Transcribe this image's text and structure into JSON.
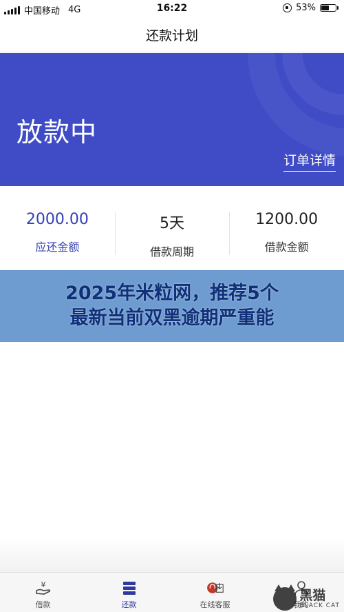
{
  "status_bar": {
    "carrier": "中国移动",
    "network": "4G",
    "time": "16:22",
    "battery": "53%",
    "battery_level": 0.53
  },
  "nav": {
    "title": "还款计划"
  },
  "banner": {
    "status": "放款中",
    "detail_link": "订单详情",
    "color": "#3f4cc6"
  },
  "stats": [
    {
      "value": "2000.00",
      "label": "应还金额"
    },
    {
      "value": "5天",
      "label": "借款周期"
    },
    {
      "value": "1200.00",
      "label": "借款金额"
    }
  ],
  "overlay": {
    "line1": "2025年米粒网，推荐5个",
    "line2": "最新当前双黑逾期严重能"
  },
  "tab_bar": {
    "items": [
      {
        "label": "借款",
        "icon": "yen-hand-icon"
      },
      {
        "label": "还款",
        "icon": "stack-icon"
      },
      {
        "label": "在线客服",
        "icon": "headset-icon"
      },
      {
        "label": "我的",
        "icon": "person-icon"
      }
    ],
    "active_index": 1
  },
  "watermark": {
    "cn": "黑猫",
    "en": "BLACK CAT"
  }
}
